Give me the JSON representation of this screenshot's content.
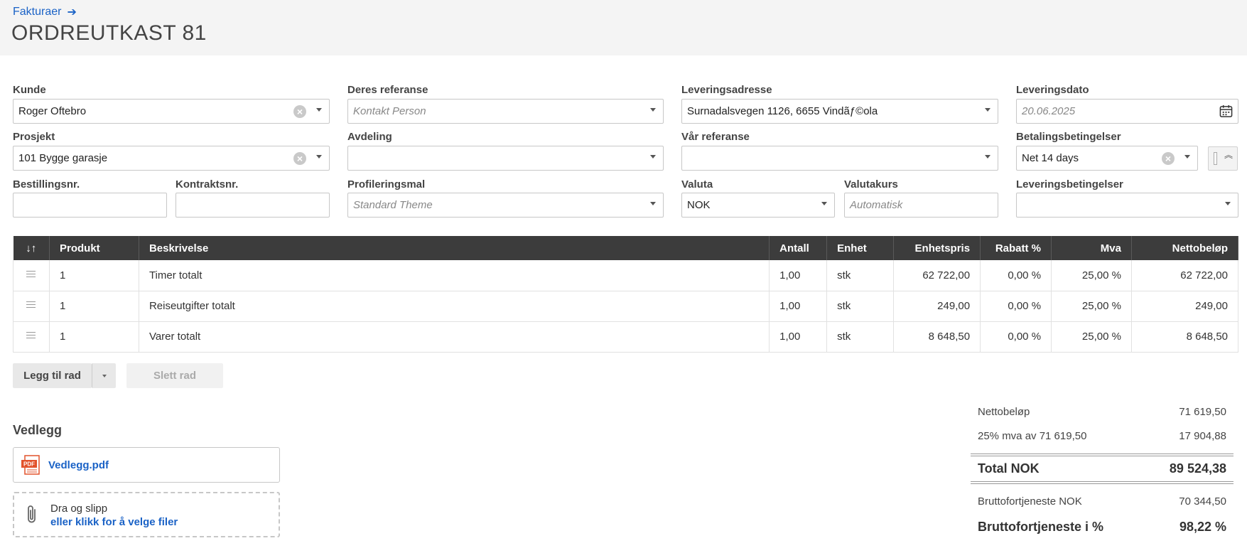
{
  "header": {
    "breadcrumb": "Fakturaer",
    "title": "ORDREUTKAST 81"
  },
  "form": {
    "kunde": {
      "label": "Kunde",
      "value": "Roger Oftebro"
    },
    "deres_referanse": {
      "label": "Deres referanse",
      "placeholder": "Kontakt Person"
    },
    "leveringsadresse": {
      "label": "Leveringsadresse",
      "value": "Surnadalsvegen 1126, 6655 Vindãƒ©ola"
    },
    "leveringsdato": {
      "label": "Leveringsdato",
      "placeholder": "20.06.2025"
    },
    "prosjekt": {
      "label": "Prosjekt",
      "value": "101 Bygge garasje"
    },
    "avdeling": {
      "label": "Avdeling",
      "value": ""
    },
    "var_referanse": {
      "label": "Vår referanse",
      "value": ""
    },
    "betalingsbetingelser": {
      "label": "Betalingsbetingelser",
      "value": "Net 14 days"
    },
    "bestillingsnr": {
      "label": "Bestillingsnr.",
      "value": ""
    },
    "kontraktsnr": {
      "label": "Kontraktsnr.",
      "value": ""
    },
    "profileringsmal": {
      "label": "Profileringsmal",
      "placeholder": "Standard Theme"
    },
    "valuta": {
      "label": "Valuta",
      "value": "NOK"
    },
    "valutakurs": {
      "label": "Valutakurs",
      "placeholder": "Automatisk"
    },
    "leveringsbetingelser": {
      "label": "Leveringsbetingelser",
      "value": ""
    }
  },
  "table": {
    "columns": {
      "sort": "↓↑",
      "produkt": "Produkt",
      "beskrivelse": "Beskrivelse",
      "antall": "Antall",
      "enhet": "Enhet",
      "enhetspris": "Enhetspris",
      "rabatt": "Rabatt %",
      "mva": "Mva",
      "netto": "Nettobeløp"
    },
    "rows": [
      {
        "produkt": "1",
        "beskrivelse": "Timer totalt",
        "antall": "1,00",
        "enhet": "stk",
        "enhetspris": "62 722,00",
        "rabatt": "0,00 %",
        "mva": "25,00 %",
        "netto": "62 722,00"
      },
      {
        "produkt": "1",
        "beskrivelse": "Reiseutgifter totalt",
        "antall": "1,00",
        "enhet": "stk",
        "enhetspris": "249,00",
        "rabatt": "0,00 %",
        "mva": "25,00 %",
        "netto": "249,00"
      },
      {
        "produkt": "1",
        "beskrivelse": "Varer totalt",
        "antall": "1,00",
        "enhet": "stk",
        "enhetspris": "8 648,50",
        "rabatt": "0,00 %",
        "mva": "25,00 %",
        "netto": "8 648,50"
      }
    ]
  },
  "actions": {
    "add_row": "Legg til rad",
    "delete_row": "Slett rad"
  },
  "attachments": {
    "title": "Vedlegg",
    "file_name": "Vedlegg.pdf",
    "file_icon_text": "PDF",
    "drop_text": "Dra og slipp",
    "drop_link": "eller klikk for å velge filer"
  },
  "totals": {
    "netto_label": "Nettobeløp",
    "netto_value": "71 619,50",
    "mva_label": "25% mva av 71 619,50",
    "mva_value": "17 904,88",
    "total_label": "Total NOK",
    "total_value": "89 524,38",
    "brutto_label": "Bruttofortjeneste NOK",
    "brutto_value": "70 344,50",
    "brutto_pct_label": "Bruttofortjeneste i %",
    "brutto_pct_value": "98,22 %"
  },
  "colors": {
    "link": "#1a62c6",
    "table_header": "#3c3c3c",
    "pdf_icon": "#e2522b"
  }
}
